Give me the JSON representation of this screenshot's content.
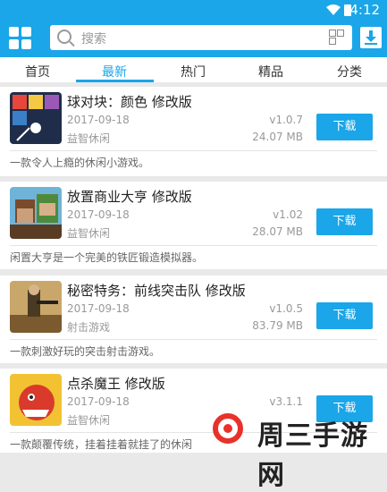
{
  "status": {
    "time": "4:12"
  },
  "search": {
    "placeholder": "搜索"
  },
  "tabs": [
    "首页",
    "最新",
    "热门",
    "精品",
    "分类"
  ],
  "apps": [
    {
      "title": "球对块：颜色 修改版",
      "date": "2017-09-18",
      "category": "益智休闲",
      "version": "v1.0.7",
      "size": "24.07 MB",
      "button": "下载",
      "desc": "一款令人上瘾的休闲小游戏。"
    },
    {
      "title": "放置商业大亨 修改版",
      "date": "2017-09-18",
      "category": "益智休闲",
      "version": "v1.02",
      "size": "28.07 MB",
      "button": "下载",
      "desc": "闲置大亨是一个完美的铁匠锻造模拟器。"
    },
    {
      "title": "秘密特务：前线突击队 修改版",
      "date": "2017-09-18",
      "category": "射击游戏",
      "version": "v1.0.5",
      "size": "83.79 MB",
      "button": "下载",
      "desc": "一款刺激好玩的突击射击游戏。"
    },
    {
      "title": "点杀魔王 修改版",
      "date": "2017-09-18",
      "category": "益智休闲",
      "version": "v3.1.1",
      "size": "",
      "button": "下载",
      "desc": "一款颠覆传统，挂着挂着就挂了的休闲"
    }
  ],
  "watermark": {
    "text": "周三手游网"
  },
  "colors": {
    "accent": "#1aa6e8"
  }
}
